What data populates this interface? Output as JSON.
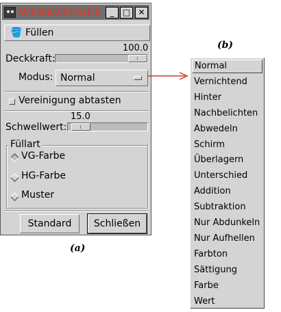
{
  "window": {
    "title": "WERKZEUGEINST…",
    "controls": [
      "_",
      "□",
      "✕"
    ]
  },
  "tool": {
    "icon": "bucket-fill-icon",
    "name": "Füllen"
  },
  "opacity": {
    "label": "Deckkraft:",
    "value_text": "100.0",
    "value": 100,
    "max": 100
  },
  "mode": {
    "label": "Modus:",
    "value": "Normal"
  },
  "sample_merged": {
    "label": "Vereinigung abtasten",
    "checked": false
  },
  "threshold": {
    "label": "Schwellwert:",
    "value_text": "15.0",
    "value": 15,
    "max": 255
  },
  "fill_type": {
    "legend": "Füllart",
    "options": [
      {
        "label": "VG-Farbe",
        "selected": true
      },
      {
        "label": "HG-Farbe",
        "selected": false
      },
      {
        "label": "Muster",
        "selected": false
      }
    ]
  },
  "buttons": {
    "standard": "Standard",
    "close": "Schließen"
  },
  "captions": {
    "a": "(a)",
    "b": "(b)"
  },
  "mode_menu": {
    "selected": "Normal",
    "items": [
      "Normal",
      "Vernichtend",
      "Hinter",
      "Nachbelichten",
      "Abwedeln",
      "Schirm",
      "Überlagern",
      "Unterschied",
      "Addition",
      "Subtraktion",
      "Nur Abdunkeln",
      "Nur Aufhellen",
      "Farbton",
      "Sättigung",
      "Farbe",
      "Wert"
    ]
  },
  "colors": {
    "title_text": "#e03a2a",
    "arrow": "#c0392b",
    "window_bg": "#d4d4d4"
  }
}
